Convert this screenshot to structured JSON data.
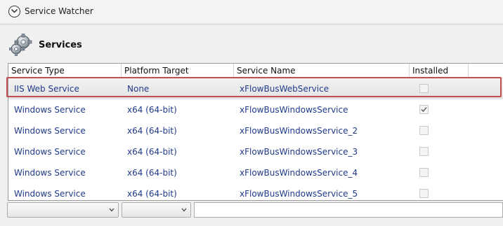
{
  "header": {
    "title": "Service Watcher"
  },
  "section": {
    "title": "Services"
  },
  "grid": {
    "columns": [
      "Service Type",
      "Platform Target",
      "Service Name",
      "Installed"
    ],
    "rows": [
      {
        "type": "IIS Web Service",
        "platform": "None",
        "name": "xFlowBusWebService",
        "installed": false
      },
      {
        "type": "Windows Service",
        "platform": "x64 (64-bit)",
        "name": "xFlowBusWindowsService",
        "installed": true
      },
      {
        "type": "Windows Service",
        "platform": "x64 (64-bit)",
        "name": "xFlowBusWindowsService_2",
        "installed": false
      },
      {
        "type": "Windows Service",
        "platform": "x64 (64-bit)",
        "name": "xFlowBusWindowsService_3",
        "installed": false
      },
      {
        "type": "Windows Service",
        "platform": "x64 (64-bit)",
        "name": "xFlowBusWindowsService_4",
        "installed": false
      },
      {
        "type": "Windows Service",
        "platform": "x64 (64-bit)",
        "name": "xFlowBusWindowsService_5",
        "installed": false
      }
    ],
    "selected_row": 0
  },
  "filters": {
    "combo1_value": "",
    "combo2_value": "",
    "text_value": ""
  },
  "colors": {
    "link_text": "#1f3a8a",
    "selection_outline": "#c0504d"
  },
  "icons": {
    "expander": "chevron-down-icon",
    "section": "gears-icon"
  }
}
